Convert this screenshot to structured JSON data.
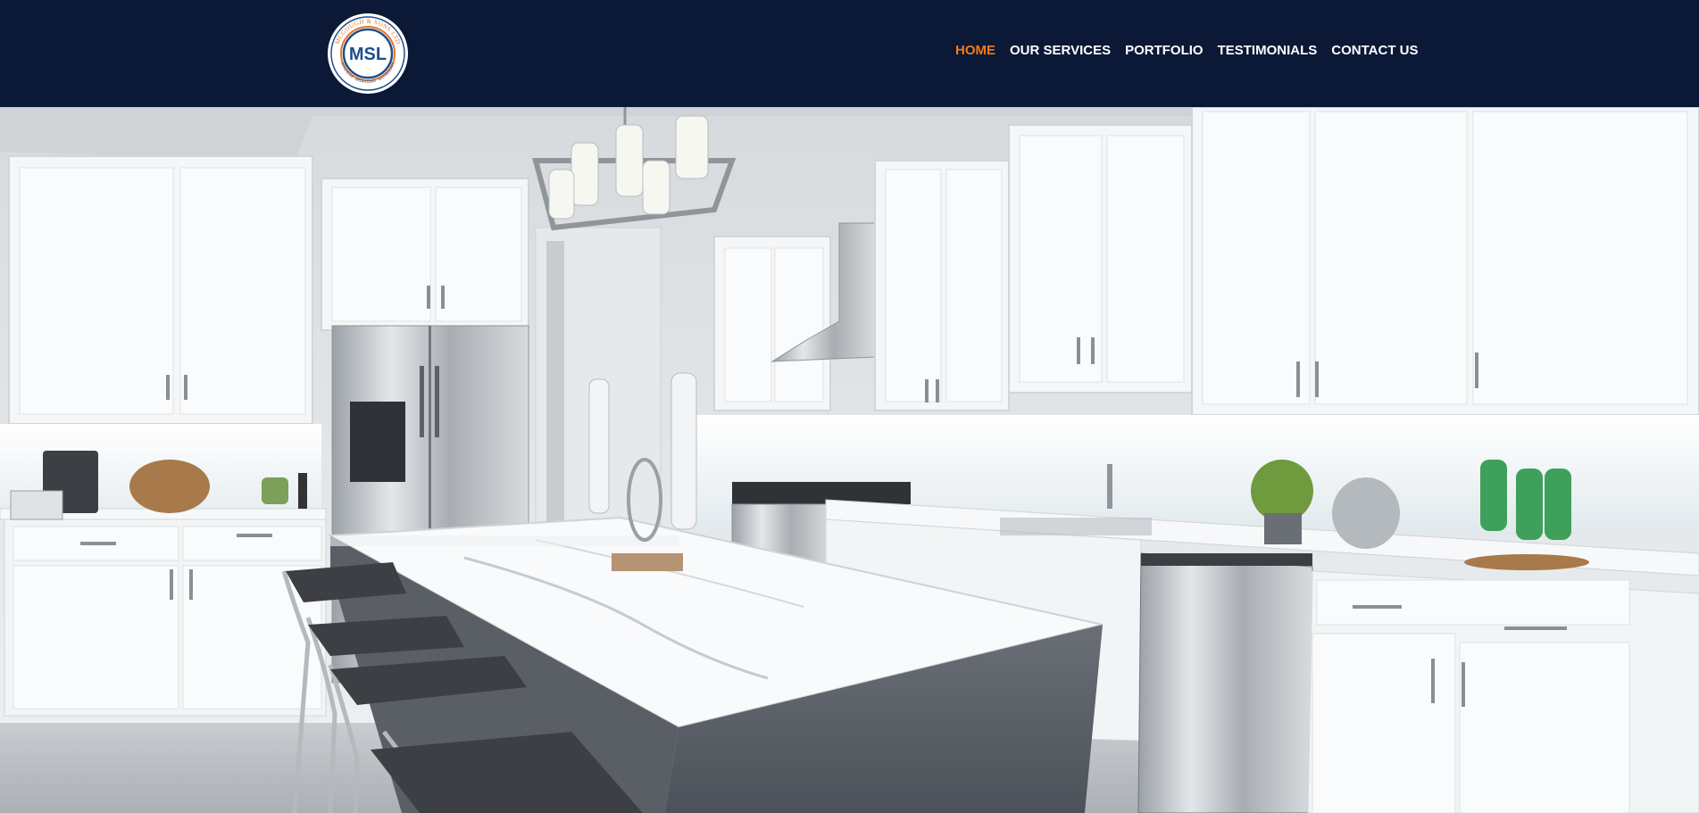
{
  "header": {
    "logo": {
      "initials": "MSL",
      "ring_text": "MCGOUGH & SONS LTD",
      "ring_text_bottom": "KITCHENS · BEDROOMS · BATHROOMS",
      "icon": "company-seal-logo"
    },
    "nav": [
      {
        "label": "HOME",
        "active": true
      },
      {
        "label": "OUR SERVICES",
        "active": false
      },
      {
        "label": "PORTFOLIO",
        "active": false
      },
      {
        "label": "TESTIMONIALS",
        "active": false
      },
      {
        "label": "CONTACT US",
        "active": false
      }
    ]
  },
  "hero": {
    "image": "kitchen-interior-photo"
  },
  "colors": {
    "header_bg": "#0b1836",
    "nav_text": "#ffffff",
    "nav_active": "#f07c16",
    "logo_blue": "#1f4e8c",
    "logo_orange": "#e8742a"
  }
}
